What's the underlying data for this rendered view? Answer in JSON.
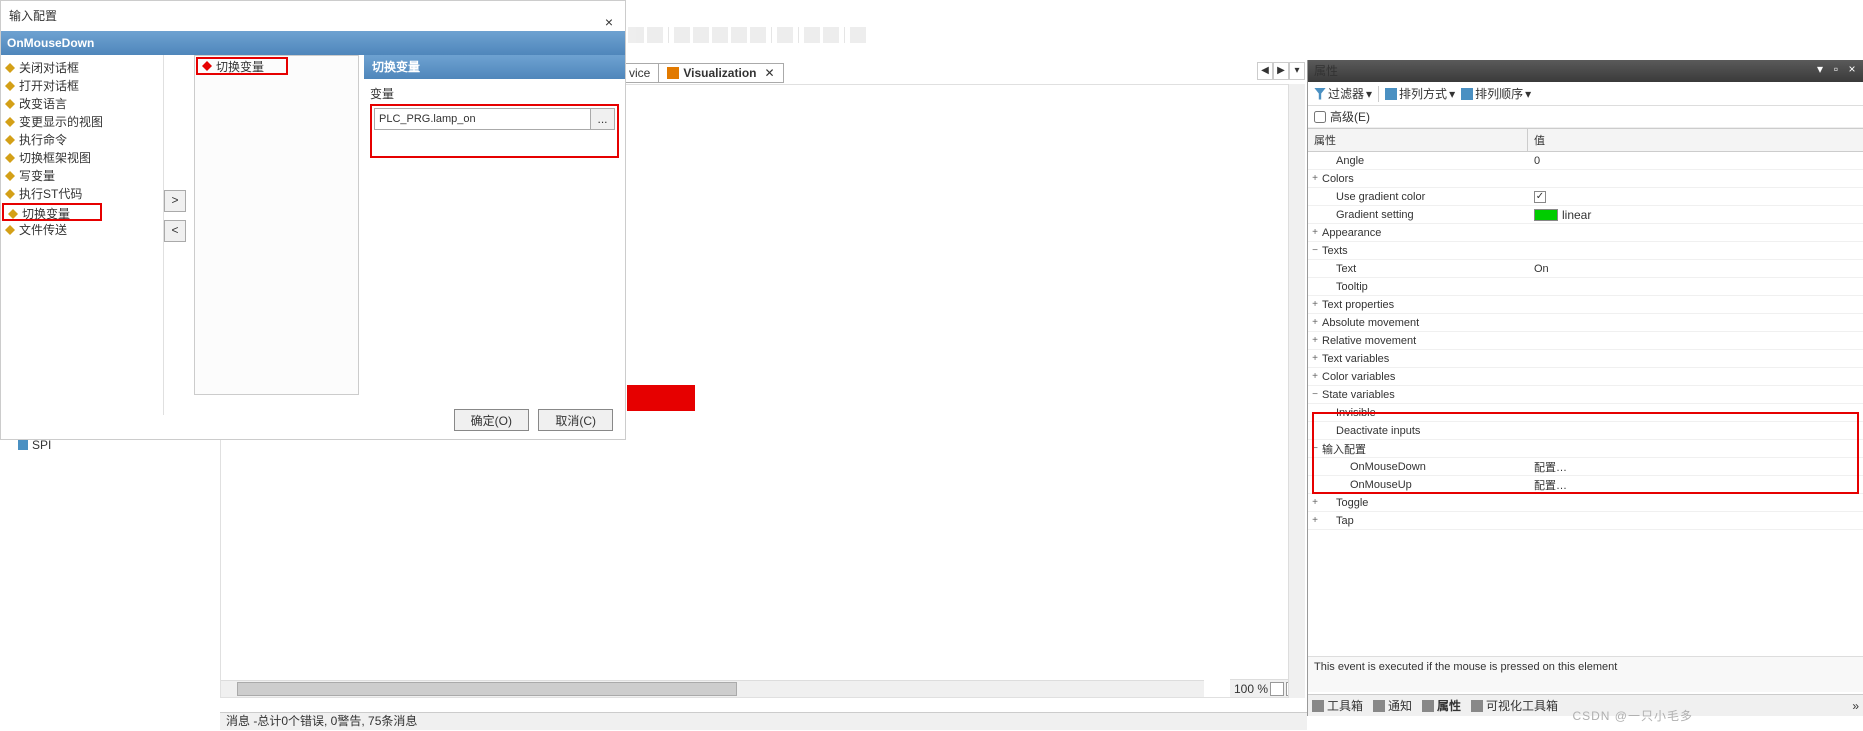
{
  "dialog": {
    "title": "输入配置",
    "header": "OnMouseDown",
    "left_items": [
      "关闭对话框",
      "打开对话框",
      "改变语言",
      "变更显示的视图",
      "执行命令",
      "切换框架视图",
      "写变量",
      "执行ST代码",
      "切换变量",
      "文件传送"
    ],
    "mid_head": "切换变量",
    "arrow_right": ">",
    "arrow_left": "<",
    "right_head": "切换变量",
    "var_label": "变量",
    "var_value": "PLC_PRG.lamp_on",
    "var_btn": "...",
    "ok": "确定(O)",
    "cancel": "取消(C)",
    "close": "×"
  },
  "spi": "SPI",
  "tab_vice": "vice",
  "tab_vis": "Visualization",
  "tab_x": "✕",
  "nav": {
    "l": "◀",
    "r": "▶",
    "d": "▾"
  },
  "zoom": {
    "pct": "100 %"
  },
  "prop": {
    "title": "属性",
    "filter": "过滤器",
    "sort1": "排列方式",
    "sort2": "排列顺序",
    "advanced": "高级(E)",
    "hdr_prop": "属性",
    "hdr_val": "值",
    "rows": {
      "angle": "Angle",
      "angle_v": "0",
      "colors": "Colors",
      "use_grad": "Use gradient color",
      "grad_set": "Gradient setting",
      "grad_v": "linear",
      "appearance": "Appearance",
      "texts": "Texts",
      "text": "Text",
      "text_v": "On",
      "tooltip": "Tooltip",
      "textprops": "Text properties",
      "absmove": "Absolute movement",
      "relmove": "Relative movement",
      "textvars": "Text variables",
      "colorvars": "Color variables",
      "statevars": "State variables",
      "invisible": "Invisible",
      "deact": "Deactivate inputs",
      "inputcfg": "输入配置",
      "onmdown": "OnMouseDown",
      "onmdown_v": "配置…",
      "onmup": "OnMouseUp",
      "onmup_v": "配置…",
      "toggle": "Toggle",
      "tap": "Tap"
    },
    "desc": "This event is executed if the mouse is pressed on this element",
    "tabs": {
      "t1": "工具箱",
      "t2": "通知",
      "t3": "属性",
      "t4": "可视化工具箱"
    }
  },
  "msgbar": "消息 -总计0个错误, 0警告, 75条消息",
  "watermark": "CSDN @一只小毛多"
}
